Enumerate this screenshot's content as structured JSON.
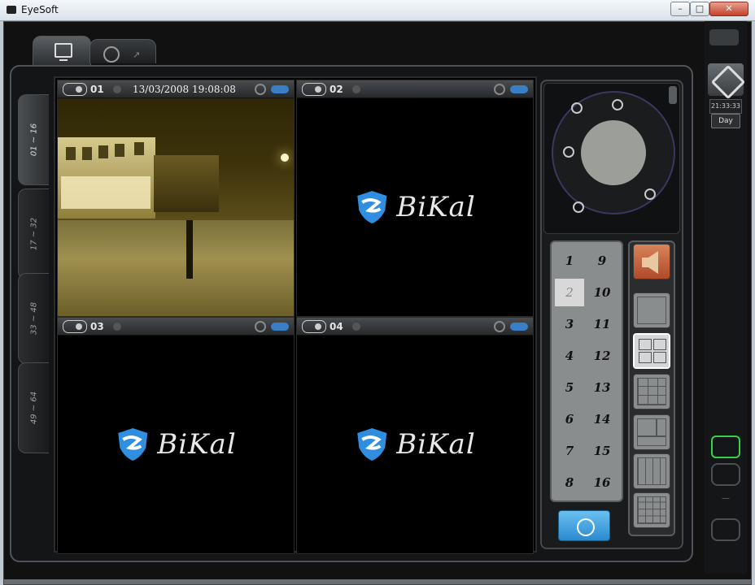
{
  "window": {
    "title": "EyeSoft",
    "min": "–",
    "max": "□",
    "close": "✕"
  },
  "tabs": [
    {
      "label": "",
      "icon": "monitor-icon"
    },
    {
      "label": "",
      "icon": "playback-icon"
    }
  ],
  "group_tabs": [
    "01 ~ 16",
    "17 ~ 32",
    "33 ~ 48",
    "49 ~ 64"
  ],
  "cameras": [
    {
      "id": "01",
      "timestamp": "13/03/2008 19:08:08",
      "feed": "live"
    },
    {
      "id": "02",
      "timestamp": "",
      "feed": "logo"
    },
    {
      "id": "03",
      "timestamp": "",
      "feed": "logo"
    },
    {
      "id": "04",
      "timestamp": "",
      "feed": "logo"
    }
  ],
  "brand": {
    "name": "BiKal",
    "shield_color": "#2f8ee0"
  },
  "channels": [
    "1",
    "2",
    "3",
    "4",
    "5",
    "6",
    "7",
    "8",
    "9",
    "10",
    "11",
    "12",
    "13",
    "14",
    "15",
    "16"
  ],
  "selected_channel": "2",
  "sidebar": {
    "time": "21:33:33",
    "mode": "Day"
  },
  "colors": {
    "accent_blue": "#2b8bd0",
    "status_green": "#3bd04a",
    "audio_orange": "#c85a34"
  }
}
